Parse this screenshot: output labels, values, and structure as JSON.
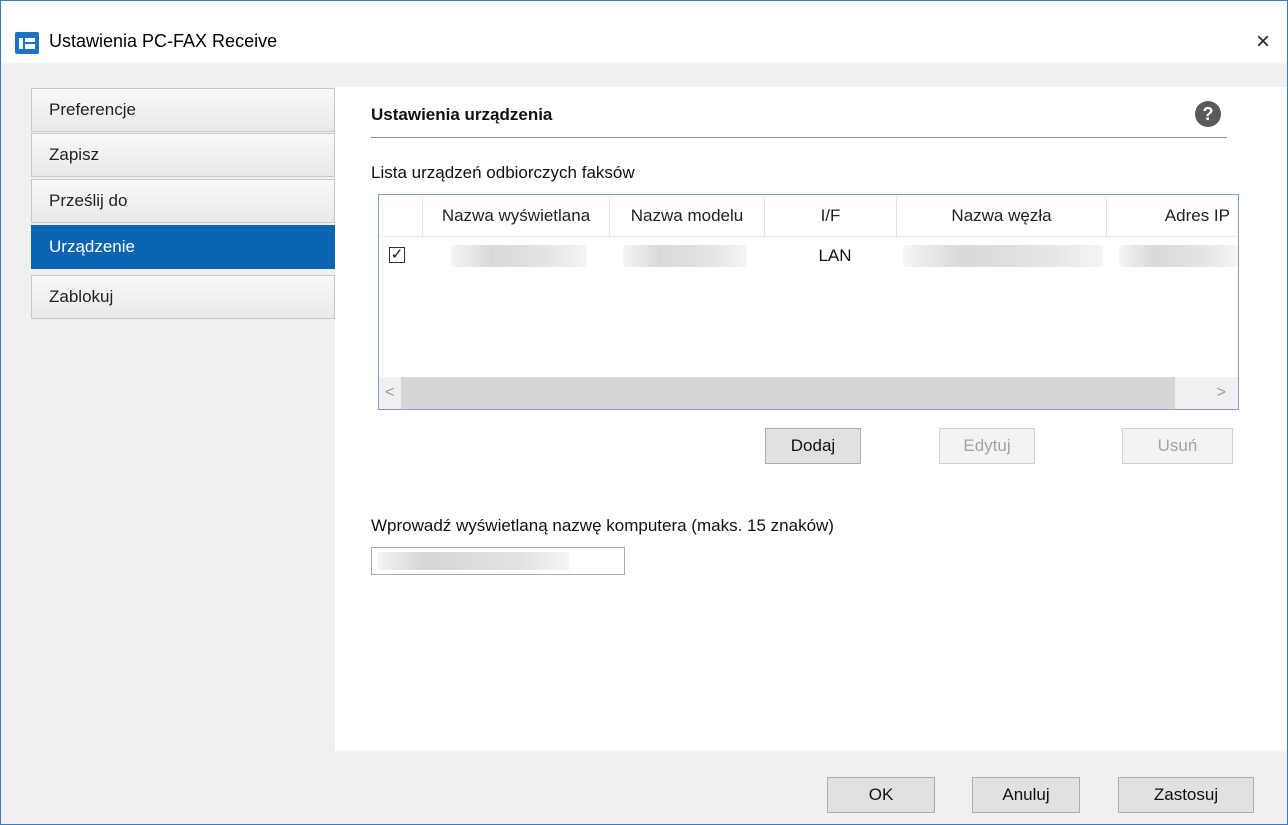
{
  "window": {
    "title": "Ustawienia PC-FAX Receive",
    "close_glyph": "×"
  },
  "nav": {
    "items": [
      {
        "label": "Preferencje",
        "active": false
      },
      {
        "label": "Zapisz",
        "active": false
      },
      {
        "label": "Prześlij do",
        "active": false
      },
      {
        "label": "Urządzenie",
        "active": true
      },
      {
        "label": "Zablokuj",
        "active": false
      }
    ]
  },
  "panel": {
    "section_title": "Ustawienia urządzenia",
    "help_glyph": "?",
    "list_label": "Lista urządzeń odbiorczych faksów",
    "table": {
      "columns": [
        "Nazwa wyświetlana",
        "Nazwa modelu",
        "I/F",
        "Nazwa węzła",
        "Adres IP"
      ],
      "rows": [
        {
          "checked": true,
          "check_glyph": "✓",
          "interface": "LAN"
        }
      ]
    },
    "scroll": {
      "left": "<",
      "right": ">"
    },
    "buttons": {
      "add": "Dodaj",
      "edit": "Edytuj",
      "delete": "Usuń"
    },
    "computer_name_label": "Wprowadź wyświetlaną nazwę komputera (maks. 15 znaków)"
  },
  "footer": {
    "ok": "OK",
    "cancel": "Anuluj",
    "apply": "Zastosuj"
  },
  "colors": {
    "accent": "#0a64b0",
    "window_border": "#3c7ac2",
    "disabled_text": "#a3a3a3"
  }
}
